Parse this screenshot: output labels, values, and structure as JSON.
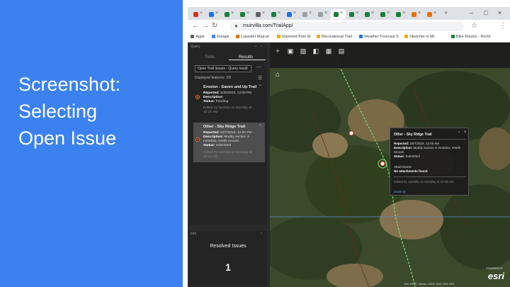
{
  "slide": {
    "title_line1": "Screenshot:",
    "title_line2": "Selecting",
    "title_line3": "Open Issue",
    "left_band_color": "#3b82f0"
  },
  "browser": {
    "url": "muirvilla.com/TrailApp/",
    "bookmarks": [
      "Apps",
      "Google",
      "Lupaster Map jd",
      "Imported from IE",
      "Recreational Trail",
      "Weather Forecast S",
      "Sketcher in Mt",
      "Bike Routes - Richh"
    ],
    "tabs_count": 18
  },
  "panel": {
    "header": "Query",
    "tab_tools": "Tools",
    "tab_results": "Results",
    "select_value": "Open Trail Issues - Query result",
    "displayed": "Displayed features: 2/2",
    "items": [
      {
        "title": "Erosion - Gaven and Up Trail",
        "reported_label": "Reported:",
        "reported": "11/5/2019, 12:00 PM",
        "description_label": "Description:",
        "description": "",
        "status_label": "Status:",
        "status": "Pending",
        "edited": "Edited by sevenia on Monday at",
        "edited_time": "10:16 AM"
      },
      {
        "title": "Other - Sky Ridge Trail",
        "reported_label": "Reported:",
        "reported": "10/7/2019, 12:00 PM",
        "description_label": "Description:",
        "description": "Muddy section in",
        "description_2": "meadow, needs reroute.",
        "status_label": "Status:",
        "status": "Submitted",
        "edited": "Edited by ruervilla on Monday at",
        "edited_time": "10:15 AM"
      }
    ]
  },
  "info": {
    "header": "Info",
    "title": "Resolved Issues",
    "count": "1"
  },
  "popup": {
    "title": "Other - Sky Ridge Trail",
    "reported_label": "Reported:",
    "reported": "10/7/2019, 12:00 AM",
    "description_label": "Description:",
    "description": "Muddy section in meadow, needs",
    "description_2": "reroute.",
    "status_label": "Status:",
    "status": "Submitted",
    "attachments_label": "Attachments",
    "attachments": "No attachments found",
    "edited": "Edited by ruervilla on Monday at 10:15 AM",
    "zoom": "Zoom to"
  },
  "map": {
    "logo": "esri",
    "powered": "POWERED BY",
    "attribution": "Esri, HERE, Garmin, USGS, NGA, EPA, NPS"
  }
}
